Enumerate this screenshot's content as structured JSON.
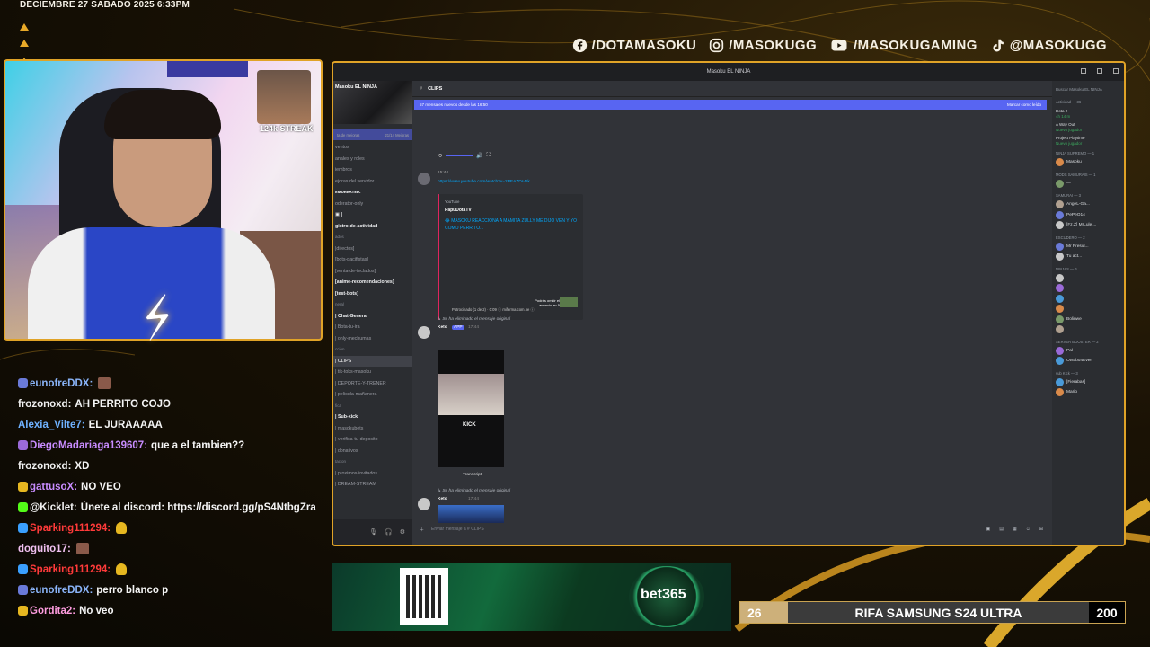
{
  "overlay": {
    "datetime": "DECIEMBRE 27 SABADO 2025 6:33PM",
    "socials": [
      {
        "icon": "facebook-icon",
        "handle": "/DOTAMASOKU"
      },
      {
        "icon": "instagram-icon",
        "handle": "/MASOKUGG"
      },
      {
        "icon": "youtube-icon",
        "handle": "/MASOKUGAMING"
      },
      {
        "icon": "tiktok-icon",
        "handle": "@MASOKUGG"
      }
    ],
    "streak_label": "124k STREAK",
    "accent_color": "#e0a327"
  },
  "chat": [
    {
      "user": "eunofreDDX:",
      "color": "#8ab4f8",
      "msg": "",
      "badge": "#6a7ad8",
      "emote": true
    },
    {
      "user": "frozonoxd:",
      "color": "#f0f0f0",
      "msg": "AH PERRITO COJO"
    },
    {
      "user": "Alexia_Vilte7:",
      "color": "#6fb2ff",
      "msg": "EL JURAAAAA"
    },
    {
      "user": "DiegoMadariaga139607:",
      "color": "#c88cff",
      "msg": "que a el tambien??",
      "badge": "#9a6ad8"
    },
    {
      "user": "frozonoxd:",
      "color": "#f0f0f0",
      "msg": "XD"
    },
    {
      "user": "gattusoX:",
      "color": "#c88cff",
      "msg": "NO VEO",
      "badge": "#e6b720"
    },
    {
      "user": "@Kicklet:",
      "color": "#f0f0f0",
      "msg": "Únete al discord: https://discord.gg/pS4NtbgZra",
      "badge": "#53fc18"
    },
    {
      "user": "Sparking111294:",
      "color": "#ff3a3a",
      "msg": "",
      "badge": "#3aa0ff",
      "hand": true
    },
    {
      "user": "doguito17:",
      "color": "#f0c0f0",
      "msg": "",
      "emote": true
    },
    {
      "user": "Sparking111294:",
      "color": "#ff3a3a",
      "msg": "",
      "badge": "#3aa0ff",
      "hand": true
    },
    {
      "user": "eunofreDDX:",
      "color": "#8ab4f8",
      "msg": "perro blanco p",
      "badge": "#6a7ad8"
    },
    {
      "user": "Gordita2:",
      "color": "#ff9de0",
      "msg": "No veo",
      "badge": "#e6b720"
    }
  ],
  "discord": {
    "window_title": "Masoku EL NINJA",
    "server_name": "Masoku EL NINJA",
    "boost_text": "ta de mejoras",
    "boost_count": "21/14 Mejoras",
    "channels": [
      {
        "label": "ventos",
        "style": ""
      },
      {
        "label": "anales y roles",
        "style": ""
      },
      {
        "label": "iembros",
        "style": ""
      },
      {
        "label": "ejoras del servidor",
        "style": ""
      },
      {
        "label": "ᴇᴍᴏʀᴇᴀᴛᴇᴅ.",
        "style": "bold"
      },
      {
        "label": "oderator-only",
        "style": ""
      },
      {
        "label": "▣ |",
        "style": "bold"
      },
      {
        "label": "gistro-de-actividad",
        "style": "bold"
      },
      {
        "label": "ados",
        "style": "cat"
      },
      {
        "label": "|directos]",
        "style": ""
      },
      {
        "label": "[bots-pacifistas]",
        "style": ""
      },
      {
        "label": "[venta-de-teclados]",
        "style": ""
      },
      {
        "label": "[anime-recomendaciones]",
        "style": "bold"
      },
      {
        "label": "[test-bots]",
        "style": "bold"
      },
      {
        "label": "neral",
        "style": "cat"
      },
      {
        "label": "| Chat-General",
        "style": "bold"
      },
      {
        "label": "| Bota-tu-ira",
        "style": ""
      },
      {
        "label": "| only-mechumas",
        "style": ""
      },
      {
        "label": "ccion",
        "style": "cat"
      },
      {
        "label": "| CLIPS",
        "style": "sel"
      },
      {
        "label": "| tik-toks-masoku",
        "style": ""
      },
      {
        "label": "| DEPORTE-Y-TRENER",
        "style": ""
      },
      {
        "label": "| pelicula-mañanera",
        "style": ""
      },
      {
        "label": "fica",
        "style": "cat"
      },
      {
        "label": "| Sub-kick",
        "style": "bold"
      },
      {
        "label": "| masokubets",
        "style": ""
      },
      {
        "label": "| verifica-tu-deposito",
        "style": ""
      },
      {
        "label": "| donativos",
        "style": ""
      },
      {
        "label": "tacion",
        "style": "cat"
      },
      {
        "label": "| proximos-invitados",
        "style": ""
      },
      {
        "label": "| DREAM-STREAM",
        "style": ""
      }
    ],
    "current_channel": "CLIPS",
    "new_messages": "57 mensajes nuevos desde las 16:50",
    "mark_read": "Marcar como leído",
    "messages": {
      "link": "https://www.youtube.com/watch?v=2PEAZDr-Nk",
      "time1": "15:44",
      "embed_source": "YouTube",
      "embed_author": "PapuDotaTV",
      "embed_title": "😂 MASOKU REACCIONA A MAMITA ZULLY ME DIJO VEN Y YO COMO PERRITO...",
      "ad_text": "Patrocinado (1 de 2) · 0:09 ⓘ miferma.com.pe ⓘ",
      "skip_text": "Podrás omitir el anuncio en 5",
      "deleted_note": "↳ Se ha eliminado el mensaje original",
      "bot_name": "Keto",
      "bot_tag": "APP",
      "time2": "17:44",
      "transcript": "Transcript",
      "clip_caption": "KICK",
      "deleted_note2": "↳ Se ha eliminado el mensaje original",
      "time3": "17:44"
    },
    "input_placeholder": "Enviar mensaje a # CLIPS",
    "members": {
      "search": "Buscar Masoku EL NINJA",
      "activity_header": "Actividad — 36",
      "activities": [
        {
          "game": "Dota 2",
          "detail": "4h 14 m"
        },
        {
          "game": "A Way Out",
          "detail": "Nuevo jugador"
        },
        {
          "game": "Project Playtime",
          "detail": "Nuevo jugador"
        }
      ],
      "groups": [
        {
          "name": "NINJA SUPREMO — 1",
          "items": [
            "Masoku"
          ]
        },
        {
          "name": "MODS SAMURAIS — 1",
          "items": [
            "—"
          ]
        },
        {
          "name": "SAMURAI — 3",
          "items": [
            "AngeL-Ga...",
            "PePeO14",
            "[Fz.Z] MrLulel..."
          ]
        },
        {
          "name": "ESCUDERO — 2",
          "items": [
            "Mr Presid...",
            "Tu act..."
          ]
        },
        {
          "name": "NINJAS — 6",
          "items": [
            "",
            "",
            "",
            "",
            "Bolinwe",
            ""
          ]
        },
        {
          "name": "SERVER BOOSTER — 2",
          "items": [
            "Pal",
            "Otsubo4Ever"
          ]
        },
        {
          "name": "sub Kick — 3",
          "items": [
            "[Fierabas]",
            "Mario"
          ]
        }
      ]
    }
  },
  "bottom": {
    "sponsor": "bet365",
    "raffle_number": "26",
    "raffle_title": "RIFA SAMSUNG S24 ULTRA",
    "raffle_total": "200"
  }
}
